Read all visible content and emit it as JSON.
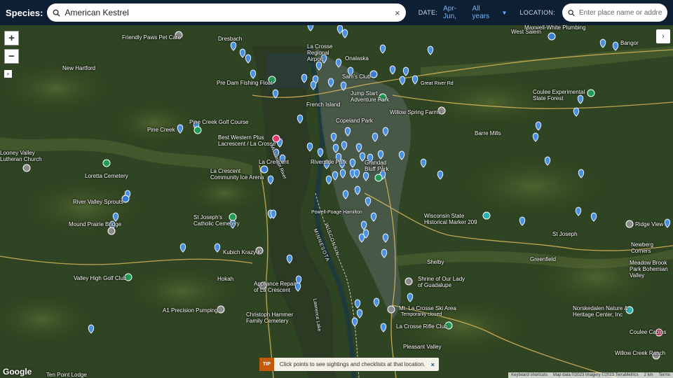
{
  "header": {
    "species_label": "Species:",
    "species_value": "American Kestrel",
    "clear_icon": "×",
    "date_label": "DATE:",
    "date_range": "Apr-Jun,",
    "date_years": "All years",
    "location_label": "LOCATION:",
    "location_placeholder": "Enter place name or address..."
  },
  "map_controls": {
    "zoom_in": "+",
    "zoom_out": "−",
    "expand": "›"
  },
  "places": {
    "friendly_paws": "Friendly Paws Pet Care",
    "dresbach": "Dresbach",
    "new_hartford": "New Hartford",
    "la_crosse_regional": "La Crosse Regional Airport",
    "onalaska": "Onalaska",
    "west_salem": "West Salem",
    "maxwell_white": "Maxwell-White Plumbing",
    "bangor": "Bangor",
    "sams_club": "Sam's Club",
    "great_river": "Great River Rd",
    "pre_dam": "Pre Dam Fishing Float",
    "jump_start": "Jump Start Adventure Park",
    "french_island": "French Island",
    "coulee_exp": "Coulee Experimental State Forest",
    "willow_spring": "Willow Spring Farms",
    "copeland_park": "Copeland Park",
    "pine_creek_golf": "Pine Creek Golf Course",
    "pine_creek": "Pine Creek",
    "barre_mills": "Barre Mills",
    "best_western": "Best Western Plus Lacrescent / La Crosse",
    "looney_valley": "Looney Valley Lutheran Church",
    "la_crescent": "La Crescent",
    "riverside_park": "Riverside Park",
    "grandad_bluff": "Grandad Bluff Park",
    "loretta": "Loretta Cemetery",
    "la_crescent_ice": "La Crescent Community Ice Arena",
    "river_valley": "River Valley Sprouts",
    "mound_prairie": "Mound Prairie Bridge",
    "st_joseph_church": "St Joseph's Catholic Cemetery",
    "powell_poage": "Powell-Poage Hamilton",
    "wisconsin_marker": "Wisconsin State Historical Marker 209",
    "st_joseph": "St Joseph",
    "ridge_view": "Ridge View",
    "newberg": "Newberg Corners",
    "kubich": "Kubich Krazy K",
    "shelby": "Shelby",
    "greenfield": "Greenfield",
    "meadow_brook": "Meadow Brook Park Bohemian Valley",
    "valley_high": "Valley High Golf Club",
    "hokah": "Hokah",
    "appliance_repair": "Appliance Repair of La Crescent",
    "shrine": "Shrine of Our Lady of Guadalupe",
    "a1_precision": "A1 Precision Pumping",
    "mt_la_crosse": "Mt. La Crosse Ski Area",
    "temporarily_closed": "Temporarily closed",
    "christoph_hammer": "Christoph Hammer Family Cemetery",
    "norskedalen": "Norskedalen Nature & Heritage Center, Inc",
    "la_crosse_rifle": "La Crosse Rifle Club",
    "coulee_cabins": "Coulee Cabins",
    "pleasant_valley": "Pleasant Valley",
    "willow_creek": "Willow Creek Ranch",
    "ten_point": "Ten Point Lodge",
    "minnesota": "MINNESOTA",
    "wisconsin": "WISCONSIN",
    "mississippi": "Mississippi River",
    "lawrence_lake": "Lawrence Lake"
  },
  "tip": {
    "badge": "TIP",
    "message": "Click points to see sightings and checklists at that location.",
    "close": "×"
  },
  "attribution": {
    "google": "Google",
    "shortcuts": "Keyboard shortcuts",
    "data": "Map data ©2023 Imagery ©2023 TerraMetrics",
    "scale": "2 km",
    "terms": "Terms"
  },
  "colors": {
    "topbar": "#0f1f33",
    "marker": "#4a90e2",
    "link": "#6fb6ff"
  }
}
